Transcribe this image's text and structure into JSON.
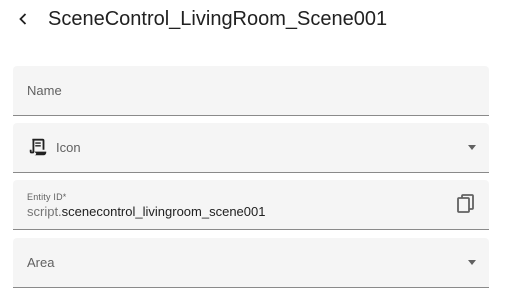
{
  "header": {
    "back_icon": "chevron-left-icon",
    "title": "SceneControl_LivingRoom_Scene001"
  },
  "form": {
    "name": {
      "label": "Name",
      "value": ""
    },
    "icon": {
      "label": "Icon",
      "icon_name": "script-text-icon"
    },
    "entity_id": {
      "label": "Entity ID*",
      "prefix": "script.",
      "value": "scenecontrol_livingroom_scene001",
      "copy_icon": "copy-icon"
    },
    "area": {
      "label": "Area",
      "value": ""
    }
  },
  "colors": {
    "field_background": "#f5f5f5",
    "text_primary": "#212121",
    "text_secondary": "#616161",
    "underline": "#8a8a8a"
  }
}
